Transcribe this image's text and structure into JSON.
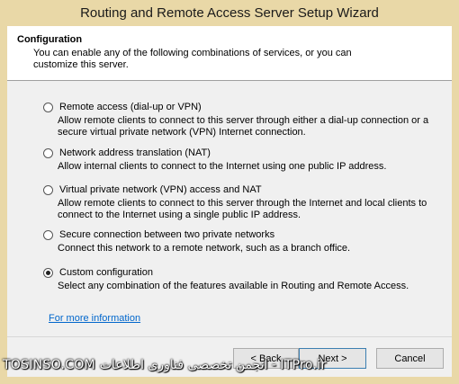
{
  "window": {
    "title": "Routing and Remote Access Server Setup Wizard"
  },
  "header": {
    "title": "Configuration",
    "description": "You can enable any of the following combinations of services, or you can customize this server."
  },
  "options": [
    {
      "label": "Remote access (dial-up or VPN)",
      "description": "Allow remote clients to connect to this server through either a dial-up connection or a secure virtual private network (VPN) Internet connection.",
      "selected": false
    },
    {
      "label": "Network address translation (NAT)",
      "description": "Allow internal clients to connect to the Internet using one public IP address.",
      "selected": false
    },
    {
      "label": "Virtual private network (VPN) access and NAT",
      "description": "Allow remote clients to connect to this server through the Internet and local clients to connect to the Internet using a single public IP address.",
      "selected": false
    },
    {
      "label": "Secure connection between two private networks",
      "description": "Connect this network to a remote network, such as a branch office.",
      "selected": false
    },
    {
      "label": "Custom configuration",
      "description": "Select any combination of the features available in Routing and Remote Access.",
      "selected": true
    }
  ],
  "link": {
    "label": "For more information"
  },
  "buttons": {
    "back": "< Back",
    "next": "Next >",
    "cancel": "Cancel"
  },
  "watermark": "TOSINSO.COM انجمن تخصصی فناوری اطلاعات - ITPro.ir"
}
